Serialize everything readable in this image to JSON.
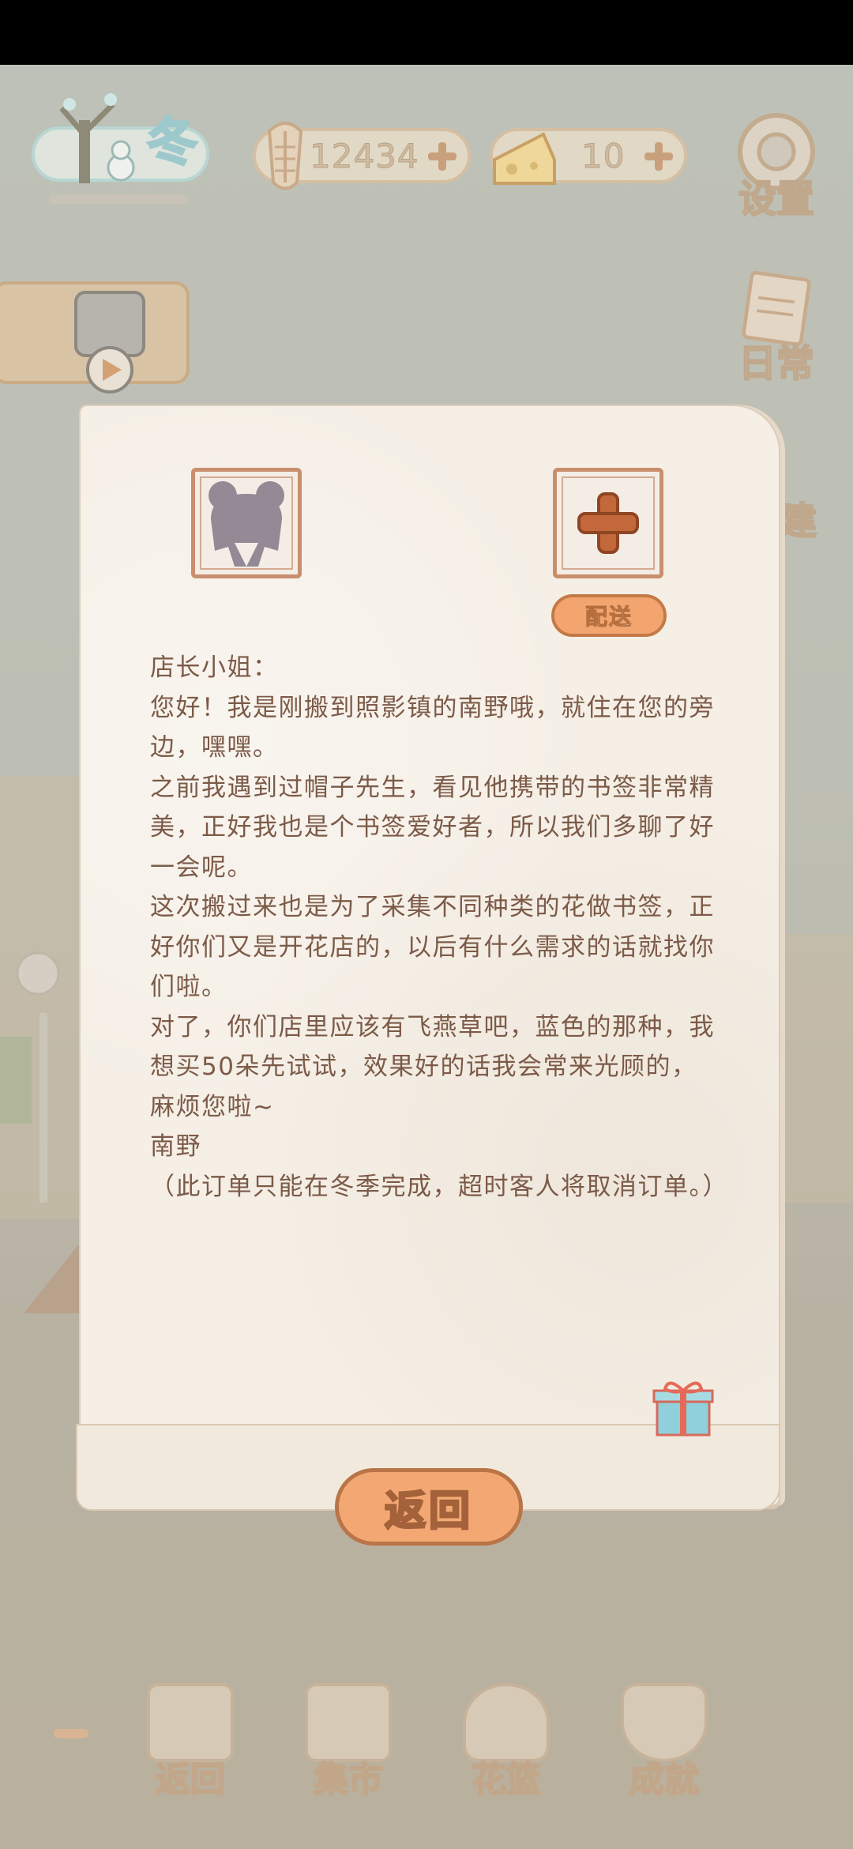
{
  "hud": {
    "season_label": "冬",
    "fish_amount": "12434",
    "cheese_amount": "10",
    "settings_label": "设置",
    "daily_label": "日常",
    "build_label": "建"
  },
  "letter": {
    "deliver_label": "配送",
    "lines": [
      "店长小姐：",
      "您好！我是刚搬到照影镇的南野哦，就住在您的旁边，嘿嘿。",
      "之前我遇到过帽子先生，看见他携带的书签非常精美，正好我也是个书签爱好者，所以我们多聊了好一会呢。",
      "这次搬过来也是为了采集不同种类的花做书签，正好你们又是开花店的，以后有什么需求的话就找你们啦。",
      "对了，你们店里应该有飞燕草吧，蓝色的那种，我想买50朵先试试，效果好的话我会常来光顾的，麻烦您啦~",
      "南野",
      "（此订单只能在冬季完成，超时客人将取消订单。）"
    ],
    "back_label": "返回"
  },
  "bottom_nav": {
    "items": [
      {
        "label": "返回",
        "icon": "window-icon"
      },
      {
        "label": "集市",
        "icon": "market-stall-icon"
      },
      {
        "label": "花篮",
        "icon": "flower-basket-icon"
      },
      {
        "label": "成就",
        "icon": "trophy-icon"
      }
    ]
  },
  "colors": {
    "accent_orange": "#f3a874",
    "letter_text": "#7c5a48",
    "paper": "#f5efe6"
  }
}
